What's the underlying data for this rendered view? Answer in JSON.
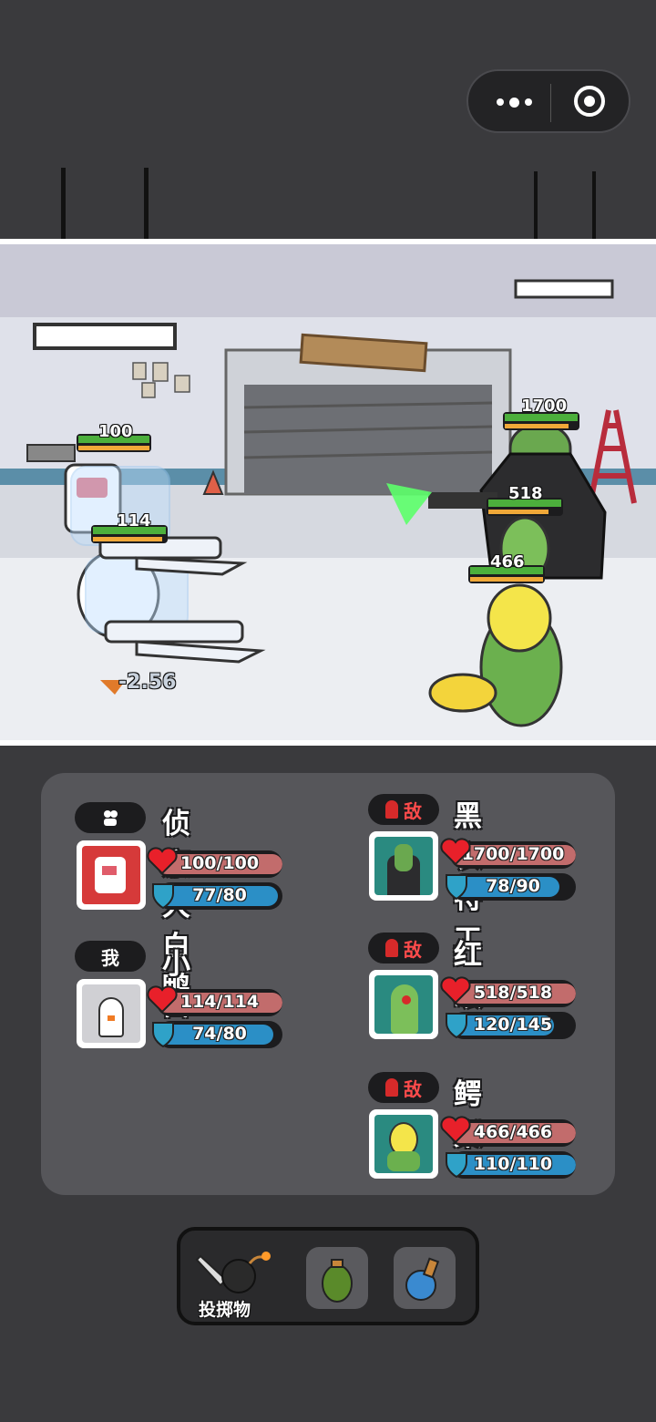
{
  "capsule": {
    "more_icon": "more-dots-icon",
    "close_icon": "target-circle-icon"
  },
  "battle": {
    "allies": [
      {
        "hp_label": "100"
      },
      {
        "hp_label": "114"
      }
    ],
    "enemies": [
      {
        "hp_label": "1700"
      },
      {
        "hp_label": "518"
      },
      {
        "hp_label": "466"
      }
    ],
    "damage_text": "-2.56"
  },
  "team": [
    {
      "tag": "",
      "tag_icon": "scout-icon",
      "name": "侦察大白鸭",
      "hp": "100/100",
      "hp_frac": 1.0,
      "shield": "77/80",
      "shield_frac": 0.9625
    },
    {
      "tag": "我",
      "name": "小白",
      "hp": "114/114",
      "hp_frac": 1.0,
      "shield": "74/80",
      "shield_frac": 0.925
    }
  ],
  "enemies": [
    {
      "tag": "敌",
      "name": "黑衣特工",
      "hp": "1700/1700",
      "hp_frac": 1.0,
      "shield": "78/90",
      "shield_frac": 0.867
    },
    {
      "tag": "敌",
      "name": "红眼",
      "hp": "518/518",
      "hp_frac": 1.0,
      "shield": "120/145",
      "shield_frac": 0.828
    },
    {
      "tag": "敌",
      "name": "鳄梨",
      "hp": "466/466",
      "hp_frac": 1.0,
      "shield": "110/110",
      "shield_frac": 1.0
    }
  ],
  "dock": {
    "throw_label": "投掷物",
    "items": [
      "grenade-icon",
      "ice-grenade-icon"
    ]
  },
  "colors": {
    "hp": "#c26c6c",
    "shield": "#2b8fc6",
    "enemy": "#d62a2a",
    "panel": "#56565a"
  }
}
